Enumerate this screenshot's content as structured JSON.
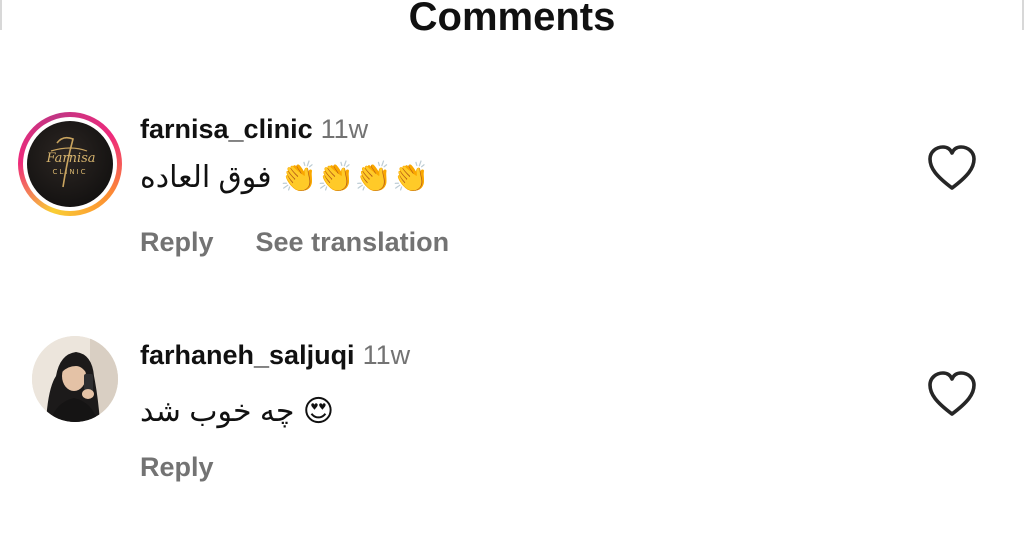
{
  "header": {
    "title": "Comments"
  },
  "comments": [
    {
      "username": "farnisa_clinic",
      "time": "11w",
      "text": "👏👏👏👏 فوق العاده",
      "has_story_ring": true,
      "avatar_logo": {
        "script": "Farnisa",
        "caption": "CLINIC"
      },
      "actions": {
        "reply": "Reply",
        "translate": "See translation"
      },
      "like_icon": "heart-outline"
    },
    {
      "username": "farhaneh_saljuqi",
      "time": "11w",
      "text": "😍 چه خوب شد",
      "actions": {
        "reply": "Reply"
      },
      "like_icon": "heart-outline"
    }
  ],
  "colors": {
    "text_primary": "#111111",
    "text_secondary": "#737373",
    "background": "#ffffff",
    "story_ring_gradient": [
      "#f9ce34",
      "#ee2a7b",
      "#c13584"
    ]
  }
}
